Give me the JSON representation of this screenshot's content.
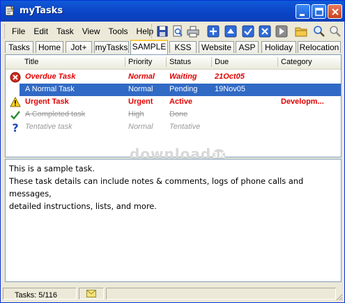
{
  "window": {
    "title": "myTasks"
  },
  "menu": [
    "File",
    "Edit",
    "Task",
    "View",
    "Tools",
    "Help"
  ],
  "toolbar_icons": [
    "save-icon",
    "preview-icon",
    "print-icon",
    "add-task-icon",
    "priority-up-icon",
    "check-icon",
    "delete-icon",
    "next-icon",
    "folder-icon",
    "find-icon",
    "find-next-icon"
  ],
  "tabs": [
    {
      "label": "Tasks"
    },
    {
      "label": "Home"
    },
    {
      "label": "Jot+"
    },
    {
      "label": "myTasks"
    },
    {
      "label": "SAMPLE",
      "active": true
    },
    {
      "label": "KSS"
    },
    {
      "label": "Website"
    },
    {
      "label": "ASP"
    },
    {
      "label": "Holiday"
    },
    {
      "label": "Relocation"
    }
  ],
  "columns": [
    "Title",
    "Priority",
    "Status",
    "Due",
    "Category"
  ],
  "tasks": [
    {
      "icon": "overdue-x-icon",
      "title": "Overdue Task",
      "priority": "Normal",
      "status": "Waiting",
      "due": "21Oct05",
      "category": ""
    },
    {
      "icon": "",
      "title": "A Normal Task",
      "priority": "Normal",
      "status": "Pending",
      "due": "19Nov05",
      "category": ""
    },
    {
      "icon": "warning-icon",
      "title": "Urgent Task",
      "priority": "Urgent",
      "status": "Active",
      "due": "",
      "category": "Developm..."
    },
    {
      "icon": "checkmark-icon",
      "title": "A Completed task",
      "priority": "High",
      "status": "Done",
      "due": "",
      "category": ""
    },
    {
      "icon": "question-icon",
      "title": "Tentative task",
      "priority": "Normal",
      "status": "Tentative",
      "due": "",
      "category": ""
    }
  ],
  "watermark": {
    "text": "download",
    "badge": "3K"
  },
  "details": {
    "line1": "This is a sample task.",
    "line2": "These task details can include notes & comments, logs of phone calls and messages,",
    "line3": "detailed instructions, lists, and more."
  },
  "status": {
    "tasks": "Tasks: 5/116"
  },
  "colors": {
    "titlebar": "#0a44c6",
    "selection": "#316ac5",
    "alert": "#e00000",
    "muted": "#9a9a9a"
  }
}
